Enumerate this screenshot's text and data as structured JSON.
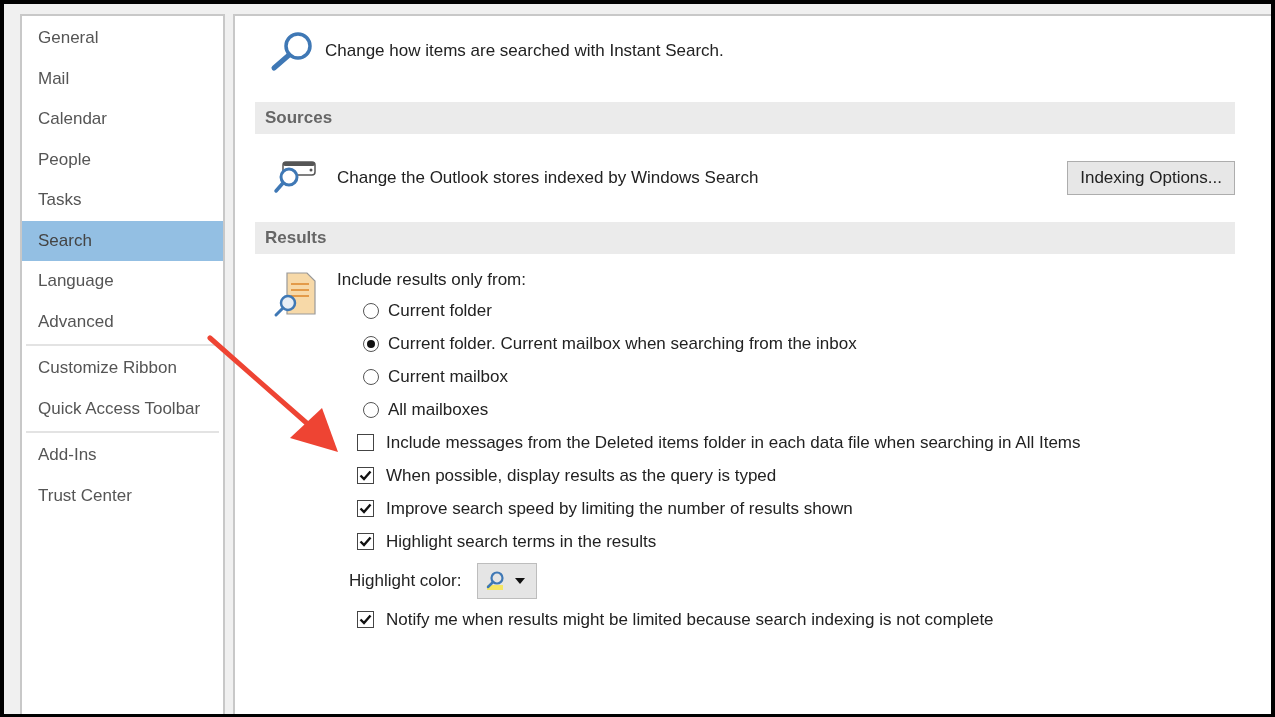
{
  "sidebar": {
    "groups": [
      [
        {
          "label": "General",
          "selected": false
        },
        {
          "label": "Mail",
          "selected": false
        },
        {
          "label": "Calendar",
          "selected": false
        },
        {
          "label": "People",
          "selected": false
        },
        {
          "label": "Tasks",
          "selected": false
        },
        {
          "label": "Search",
          "selected": true
        },
        {
          "label": "Language",
          "selected": false
        },
        {
          "label": "Advanced",
          "selected": false
        }
      ],
      [
        {
          "label": "Customize Ribbon",
          "selected": false
        },
        {
          "label": "Quick Access Toolbar",
          "selected": false
        }
      ],
      [
        {
          "label": "Add-Ins",
          "selected": false
        },
        {
          "label": "Trust Center",
          "selected": false
        }
      ]
    ]
  },
  "intro": "Change how items are searched with Instant Search.",
  "sources": {
    "heading": "Sources",
    "description": "Change the Outlook stores indexed by Windows Search",
    "button": "Indexing Options..."
  },
  "results": {
    "heading": "Results",
    "radio_label": "Include results only from:",
    "radios": [
      {
        "label": "Current folder",
        "selected": false
      },
      {
        "label": "Current folder. Current mailbox when searching from the inbox",
        "selected": true
      },
      {
        "label": "Current mailbox",
        "selected": false
      },
      {
        "label": "All mailboxes",
        "selected": false
      }
    ],
    "options": [
      {
        "kind": "checkbox",
        "label": "Include messages from the Deleted items folder in each data file when searching in All Items",
        "checked": false
      },
      {
        "kind": "checkbox",
        "label": "When possible, display results as the query is typed",
        "checked": true
      },
      {
        "kind": "checkbox",
        "label": "Improve search speed by limiting the number of results shown",
        "checked": true
      },
      {
        "kind": "checkbox",
        "label": "Highlight search terms in the results",
        "checked": true
      },
      {
        "kind": "color_picker",
        "label": "Highlight color:",
        "color": "#f5e663"
      },
      {
        "kind": "checkbox",
        "label": "Notify me when results might be limited because search indexing is not complete",
        "checked": true
      }
    ]
  }
}
